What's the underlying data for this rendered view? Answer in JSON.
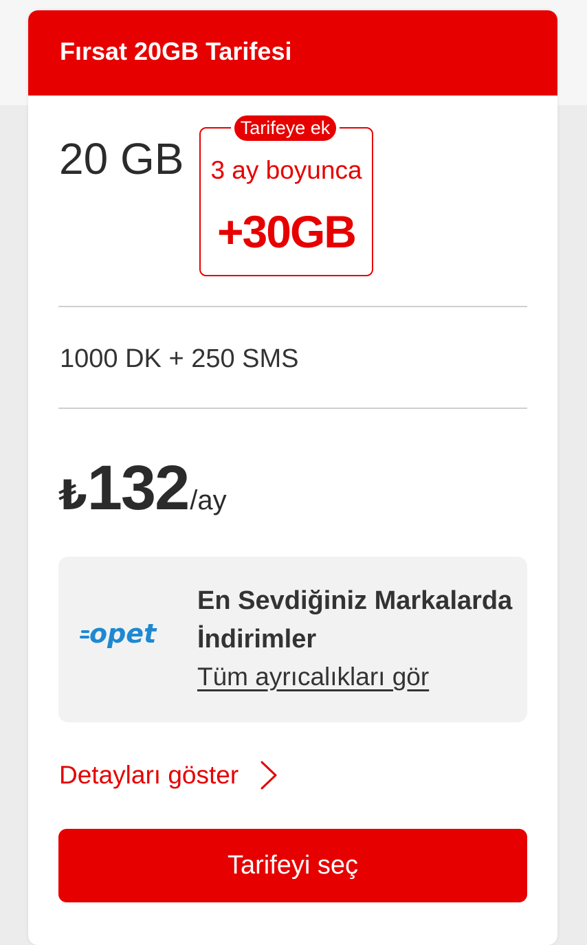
{
  "colors": {
    "brand_red": "#e60000",
    "page_background": "#ececec",
    "card_background": "#ffffff",
    "perk_background": "#f2f2f2",
    "text_dark": "#333333"
  },
  "tariff": {
    "title": "Fırsat 20GB Tarifesi",
    "data_amount": "20 GB",
    "promo": {
      "tag": "Tarifeye ek",
      "duration": "3 ay boyunca",
      "bonus": "+30GB"
    },
    "minutes_sms": "1000 DK + 250 SMS",
    "price": {
      "currency": "₺",
      "amount": "132",
      "period": "/ay"
    }
  },
  "perk": {
    "logo_icon": "opet-logo",
    "logo_text": "opet",
    "title": "En Sevdiğiniz Markalarda İndirimler",
    "link": "Tüm ayrıcalıkları gör"
  },
  "details_link": {
    "label": "Detayları göster",
    "icon": "chevron-right-icon"
  },
  "select_button": {
    "label": "Tarifeyi seç"
  }
}
